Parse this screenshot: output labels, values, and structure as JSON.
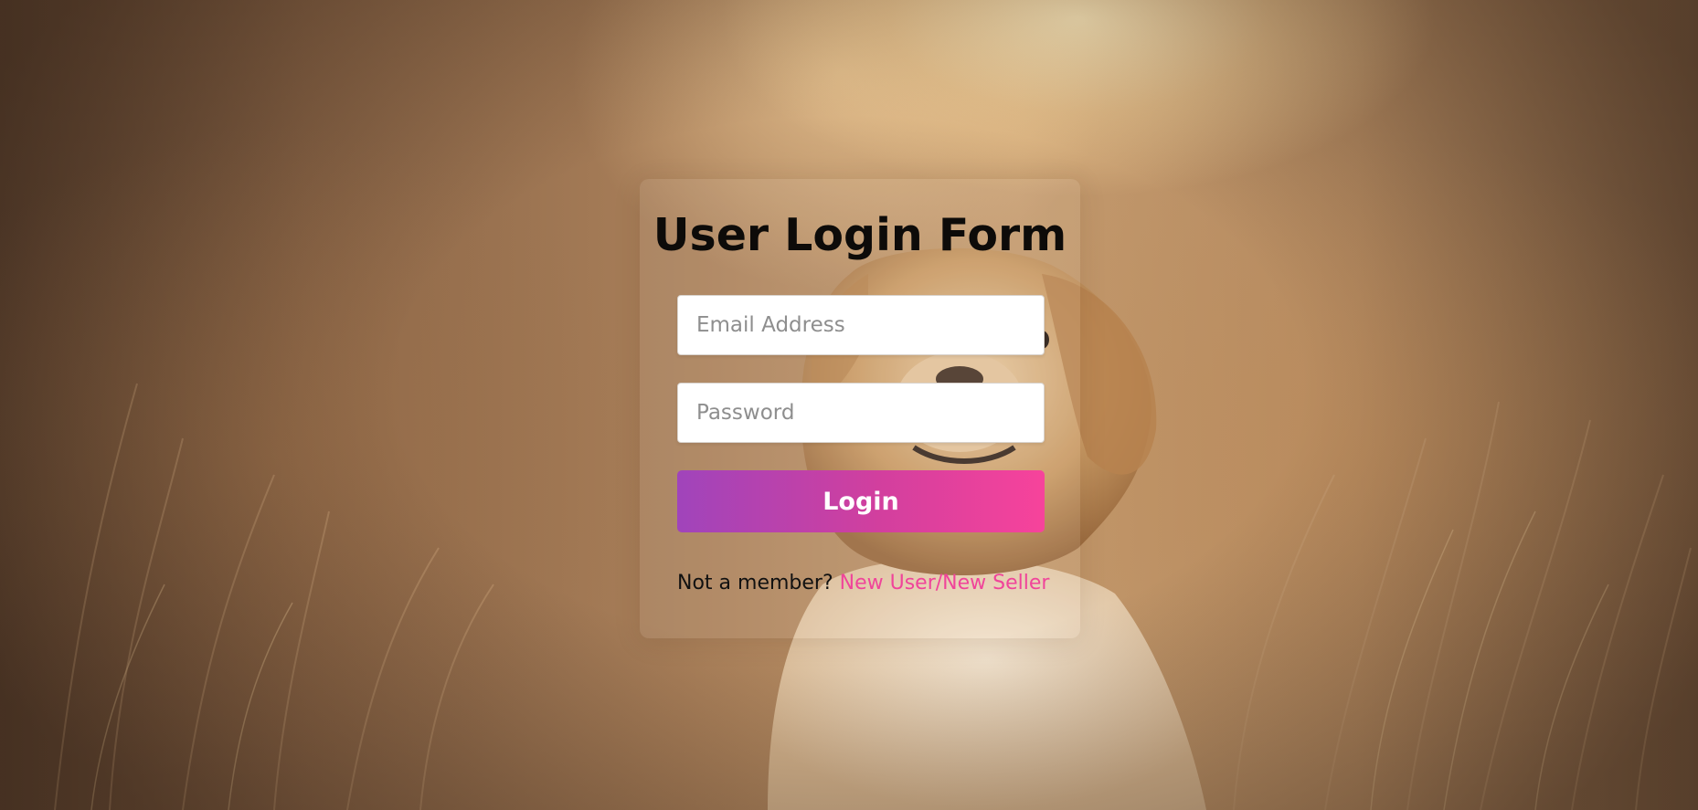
{
  "form": {
    "title": "User Login Form",
    "email_placeholder": "Email Address",
    "password_placeholder": "Password",
    "login_label": "Login",
    "signup_prompt": "Not a member?",
    "signup_link": "New User/New Seller"
  },
  "colors": {
    "button_gradient_start": "#a044bb",
    "button_gradient_end": "#f7439b",
    "link": "#f0449a"
  }
}
